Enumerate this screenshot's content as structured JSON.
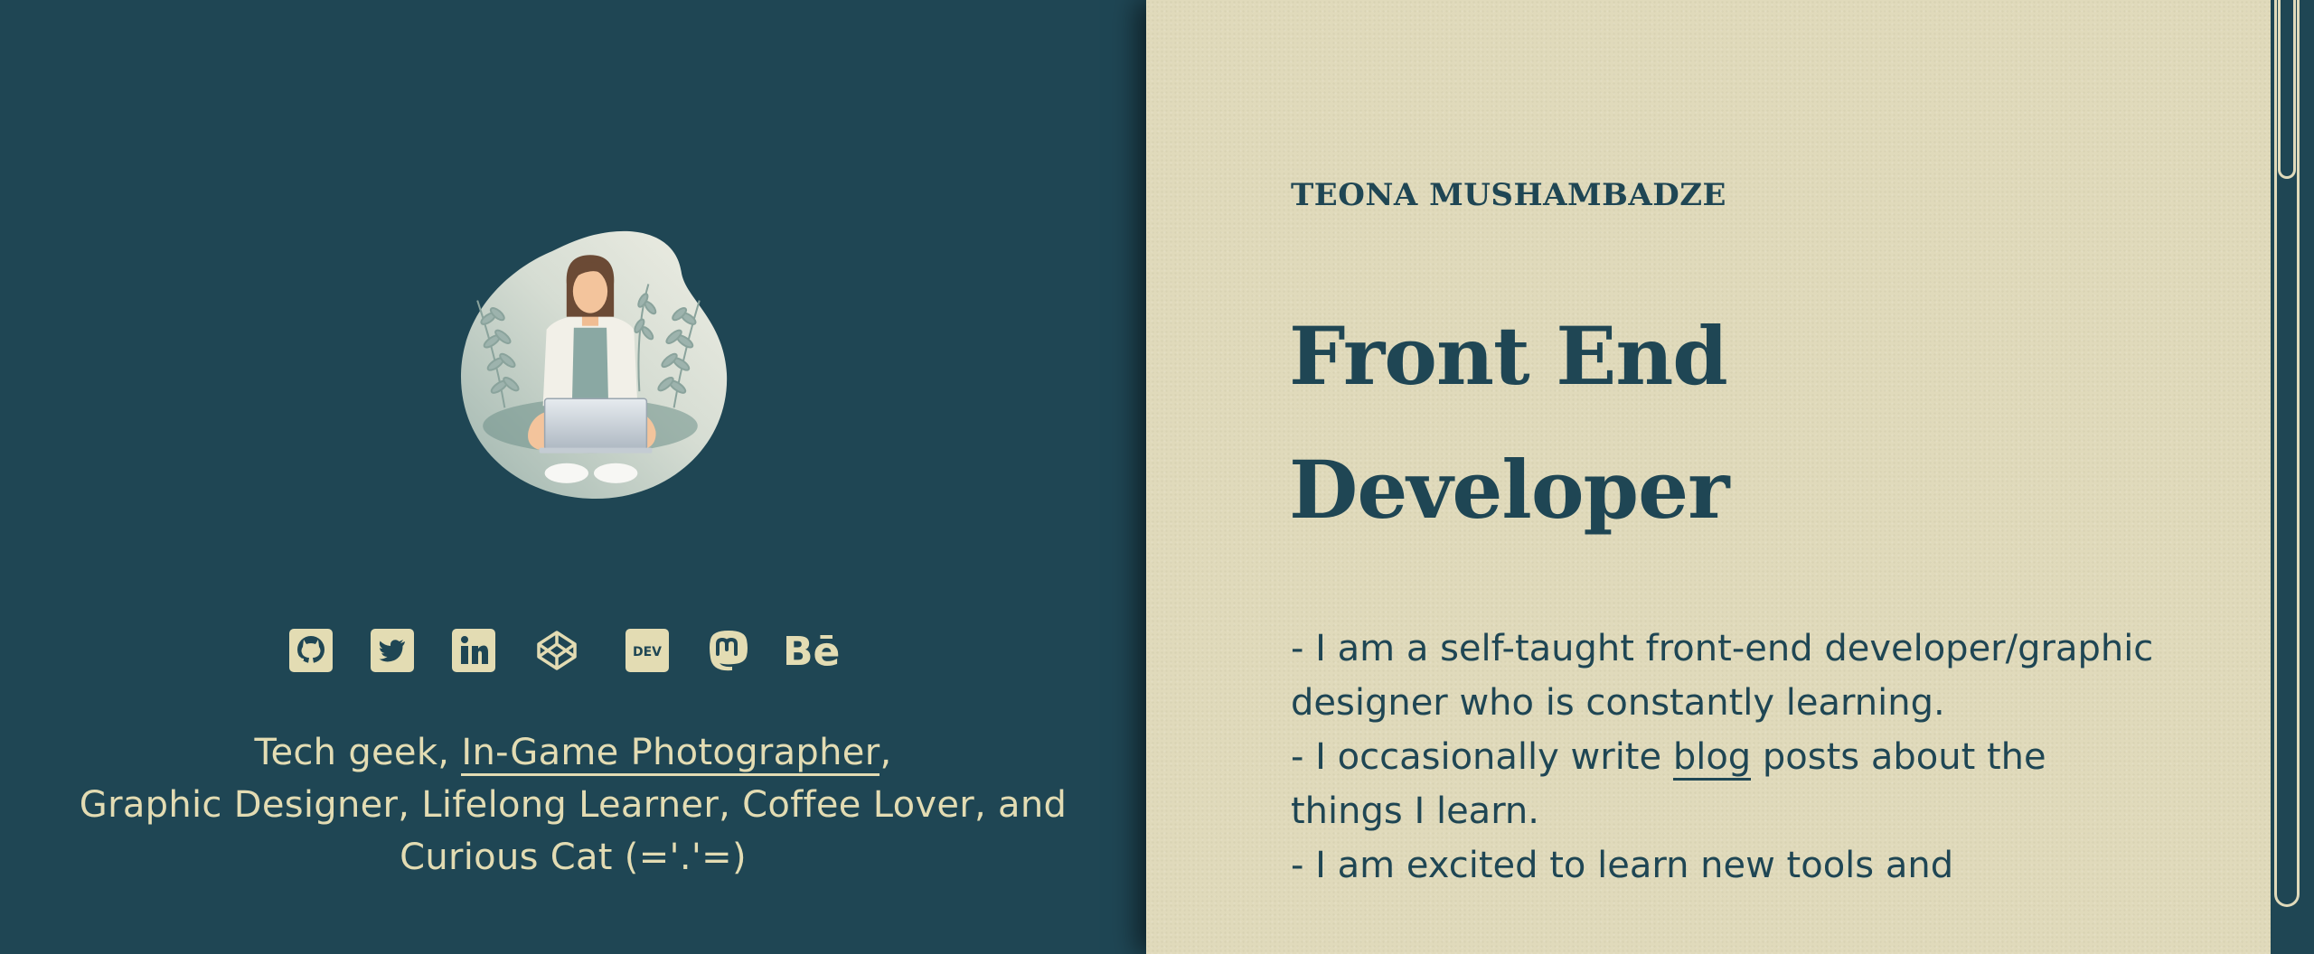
{
  "profile": {
    "name": "TEONA MUSHAMBADZE",
    "role_line1": "Front End",
    "role_line2": "Developer"
  },
  "social_links": [
    {
      "name": "github-icon",
      "label": "GitHub"
    },
    {
      "name": "twitter-icon",
      "label": "Twitter"
    },
    {
      "name": "linkedin-icon",
      "label": "LinkedIn"
    },
    {
      "name": "codepen-icon",
      "label": "CodePen"
    },
    {
      "name": "dev-icon",
      "label": "DEV"
    },
    {
      "name": "mastodon-icon",
      "label": "Mastodon"
    },
    {
      "name": "behance-icon",
      "label": "Behance"
    }
  ],
  "bio": {
    "line1_prefix": "Tech geek, ",
    "photographer_link": "In-Game Photographer",
    "line1_suffix": ",",
    "line2": "Graphic Designer, Lifelong Learner, Coffee Lover, and",
    "line3": "Curious Cat (='.'=)"
  },
  "about": {
    "line1": "- I am a self-taught front-end developer/graphic designer who is constantly learning.",
    "line2_prefix": "- I occasionally write ",
    "blog_link": "blog",
    "line2_suffix": " posts about the things I learn.",
    "line3": "- I am excited to learn new tools and"
  },
  "colors": {
    "dark_teal": "#1f4654",
    "cream": "#e0dabb",
    "cream_text": "#e3dcb3"
  }
}
